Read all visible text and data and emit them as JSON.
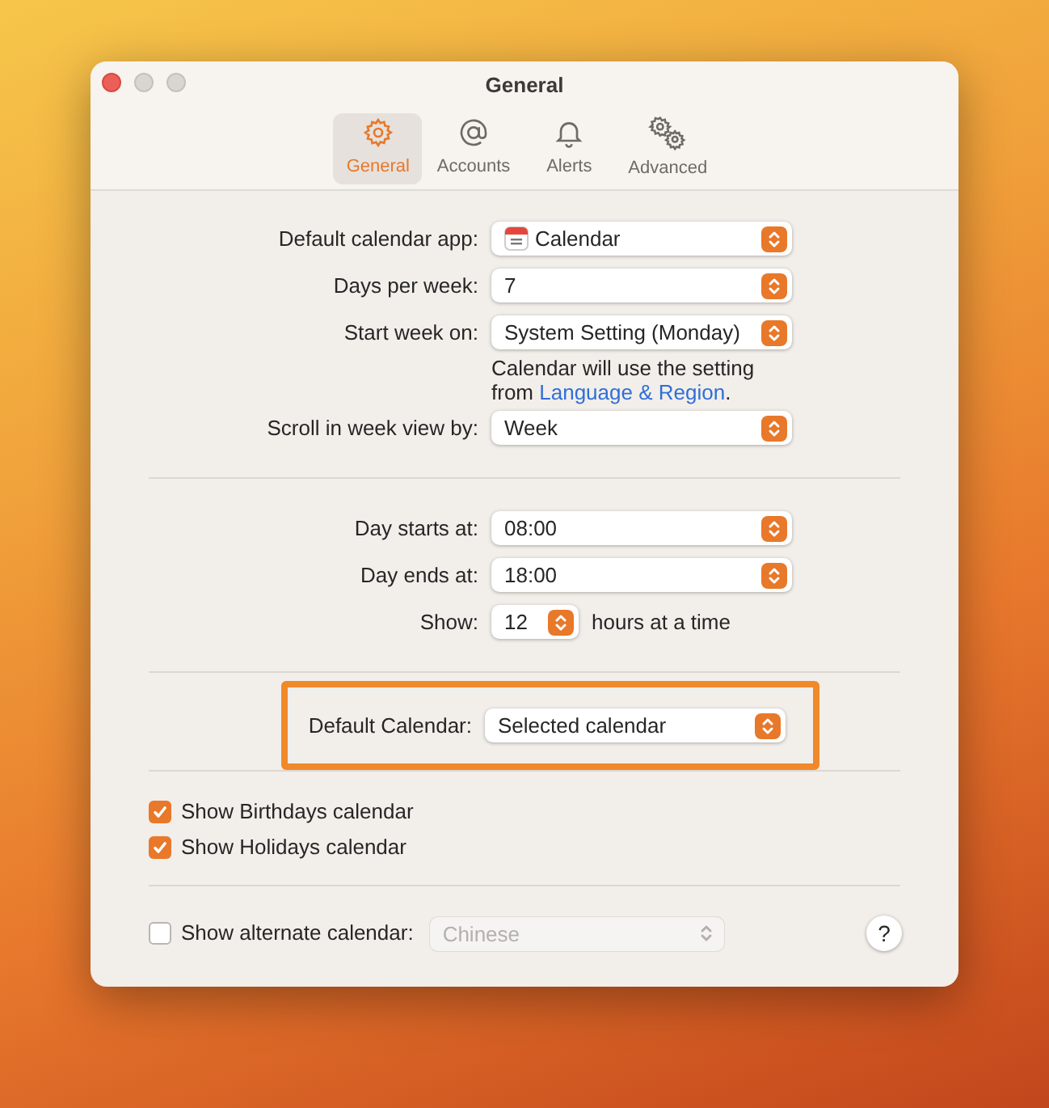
{
  "window": {
    "title": "General"
  },
  "tabs": [
    {
      "label": "General",
      "selected": true
    },
    {
      "label": "Accounts",
      "selected": false
    },
    {
      "label": "Alerts",
      "selected": false
    },
    {
      "label": "Advanced",
      "selected": false
    }
  ],
  "calendar_rows": [
    {
      "kind": "popup",
      "label": "Default calendar app:",
      "value": "Calendar",
      "app_icon": true
    },
    {
      "kind": "popup",
      "label": "Days per week:",
      "value": "7"
    },
    {
      "kind": "popup",
      "label": "Start week on:",
      "value": "System Setting (Monday)"
    },
    {
      "kind": "note",
      "text": "Calendar will use the setting from",
      "link": "Language & Region",
      "suffix": "."
    },
    {
      "kind": "popup",
      "label": "Scroll in week view by:",
      "value": "Week"
    }
  ],
  "time_rows": [
    {
      "kind": "popup",
      "label": "Day starts at:",
      "value": "08:00"
    },
    {
      "kind": "popup",
      "label": "Day ends at:",
      "value": "18:00"
    },
    {
      "kind": "stepper",
      "label": "Show:",
      "value": "12",
      "suffix": "hours at a time"
    }
  ],
  "default_calendar": {
    "label": "Default Calendar:",
    "value": "Selected calendar",
    "highlighted": true
  },
  "checkboxes": [
    {
      "label": "Show Birthdays calendar",
      "checked": true
    },
    {
      "label": "Show Holidays calendar",
      "checked": true
    }
  ],
  "alternate_calendar": {
    "label": "Show alternate calendar:",
    "checked": false,
    "value": "Chinese",
    "disabled": true
  },
  "help_button": "?"
}
